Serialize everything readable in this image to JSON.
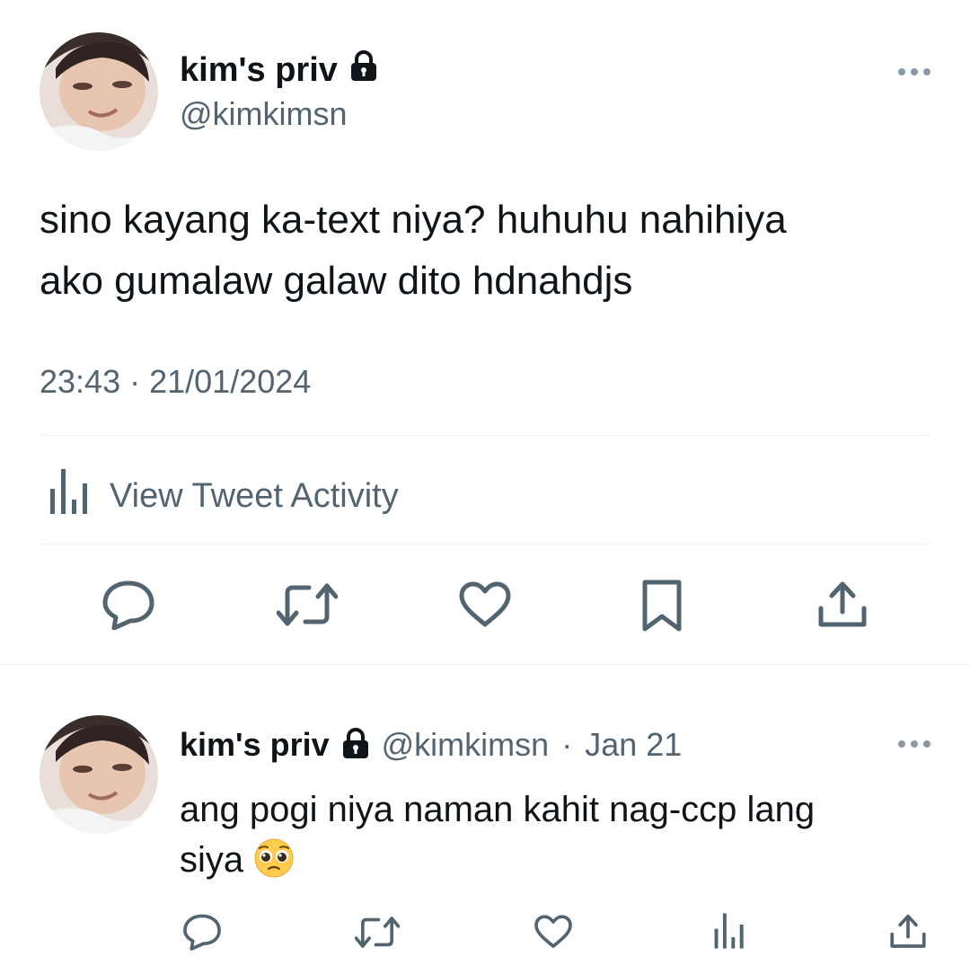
{
  "tweet": {
    "author_name": "kim's priv",
    "author_handle": "@kimkimsn",
    "text_line1": "sino kayang ka-text niya? huhuhu nahihiya",
    "text_line2": "ako gumalaw galaw dito hdnahdjs",
    "time": "23:43",
    "date": "21/01/2024",
    "view_activity_label": "View Tweet Activity"
  },
  "reply": {
    "author_name": "kim's priv",
    "author_handle": "@kimkimsn",
    "date": "Jan 21",
    "text_line1": "ang pogi niya naman kahit nag-ccp lang",
    "text_line2": "siya",
    "emoji": "pleading-face"
  },
  "icons": {
    "lock": "lock-icon",
    "reply": "reply-icon",
    "retweet": "retweet-icon",
    "like": "heart-icon",
    "bookmark": "bookmark-icon",
    "share": "share-icon",
    "analytics": "analytics-icon",
    "more": "more-icon"
  },
  "colors": {
    "text_primary": "#0f1419",
    "text_secondary": "#536471",
    "divider": "#eff3f4"
  }
}
